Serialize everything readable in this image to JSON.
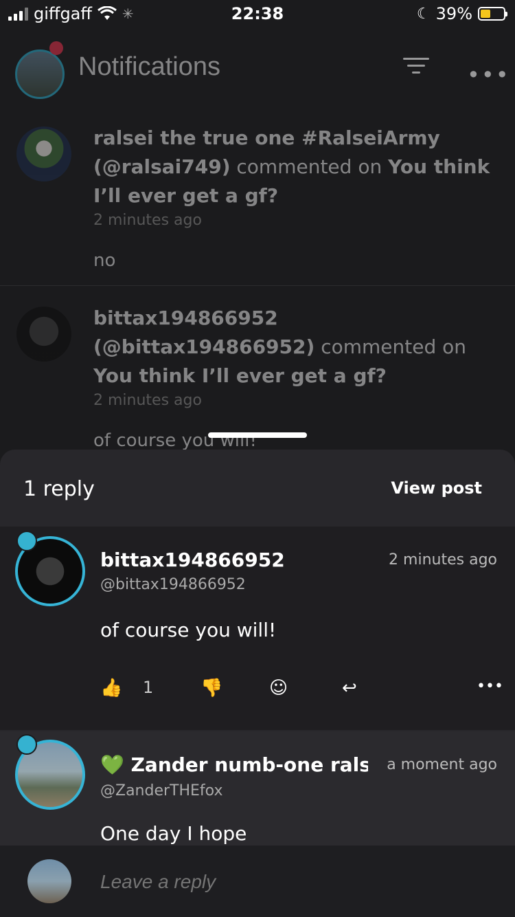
{
  "status_bar": {
    "carrier": "giffgaff",
    "time": "22:38",
    "battery": "39%"
  },
  "header": {
    "title": "Notifications"
  },
  "notifications": [
    {
      "name": "ralsei the true one #RalseiArmy",
      "handle": "(@ralsai749)",
      "action": "commented on",
      "post": "You think I’ll ever get a gf?",
      "time": "2 minutes ago",
      "body": "no"
    },
    {
      "name": "bittax194866952",
      "handle": "(@bittax194866952)",
      "action": "commented on",
      "post": "You think I’ll ever get a gf?",
      "time": "2 minutes ago",
      "body": "of course you will!"
    }
  ],
  "sheet": {
    "reply_count": "1 reply",
    "view_post": "View post",
    "comments": [
      {
        "name": "bittax194866952",
        "handle": "@bittax194866952",
        "time": "2 minutes ago",
        "text": "of course you will!",
        "likes": "1"
      },
      {
        "emoji": "💚",
        "name": "Zander numb-one ralsei",
        "handle": "@ZanderTHEfox",
        "time": "a moment ago",
        "text": "One day I hope"
      }
    ]
  },
  "reply_bar": {
    "placeholder": "Leave a reply"
  },
  "colors": {
    "accent_ring": "#36b4d6",
    "sheet_bg": "#28272b",
    "page_bg": "#1b1b1d",
    "notif_dot": "#e0304a"
  }
}
